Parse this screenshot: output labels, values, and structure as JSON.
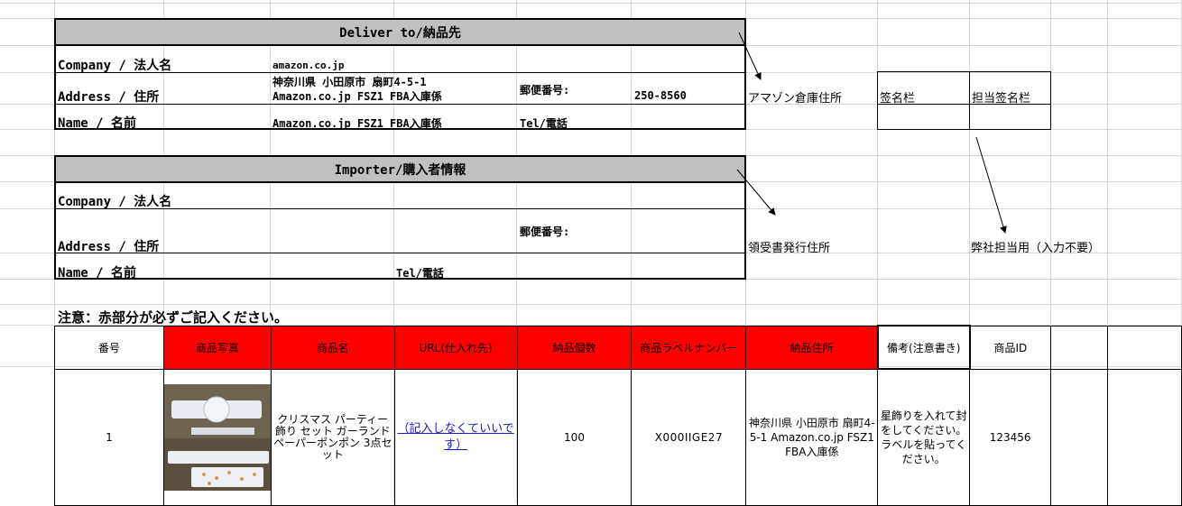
{
  "deliver": {
    "title": "Deliver to/納品先",
    "company_label": "Company / 法人名",
    "company_value": "amazon.co.jp",
    "address_label": "Address / 住所",
    "address_line1": "神奈川県 小田原市 扇町4-5-1",
    "address_line2": "Amazon.co.jp FSZ1 FBA入庫係",
    "postal_label": "郵便番号:",
    "postal_value": "250-8560",
    "name_label": "Name / 名前",
    "name_value": "Amazon.co.jp FSZ1 FBA入庫係",
    "tel_label": "Tel/電話"
  },
  "notes": {
    "amazon_address": "アマゾン倉庫住所",
    "signature": "签名栏",
    "staff_signature": "担当签名栏",
    "receipt_address": "領受書発行住所",
    "staff_use": "弊社担当用（入力不要）"
  },
  "importer": {
    "title": "Importer/購入者情報",
    "company_label": "Company / 法人名",
    "address_label": "Address / 住所",
    "postal_label": "郵便番号:",
    "name_label": "Name / 名前",
    "tel_label": "Tel/電話"
  },
  "warning": "注意：赤部分が必ずご記入ください。",
  "table": {
    "headers": [
      "番号",
      "商品写真",
      "商品名",
      "URL(仕入れ先)",
      "納品個数",
      "商品ラベルナンバー",
      "納品住所",
      "備考(注意書き)",
      "商品ID"
    ],
    "rows": [
      {
        "no": "1",
        "product_name": "クリスマス パーティー 飾り セット ガーランド ペーパーポンポン 3点セット",
        "url_text": "（記入しなくていいです）",
        "quantity": "100",
        "label_number": "X000IIGE27",
        "address": "神奈川県 小田原市 扇町4-5-1 Amazon.co.jp FSZ1 FBA入庫係",
        "remark": "星飾りを入れて封をしてください。ラベルを貼ってください。",
        "product_id": "123456"
      }
    ]
  },
  "colors": {
    "required_header": "#ff0000",
    "title_bar": "#c0c0c0",
    "link": "#1a1acc"
  }
}
